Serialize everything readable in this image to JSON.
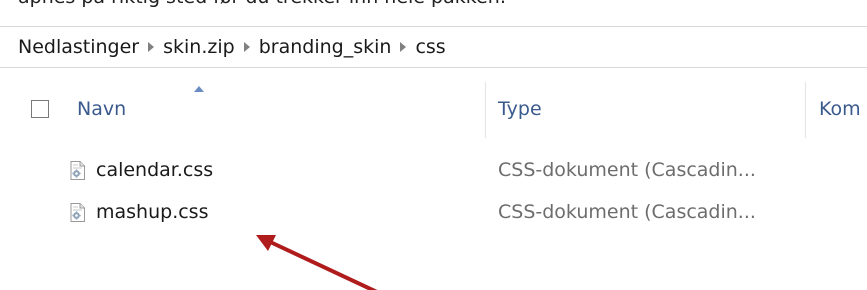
{
  "top_text": "åpnes på riktig sted før du trekker inn hele pakken:",
  "breadcrumb": {
    "items": [
      "Nedlastinger",
      "skin.zip",
      "branding_skin",
      "css"
    ]
  },
  "columns": {
    "name": "Navn",
    "type": "Type",
    "comment": "Kom"
  },
  "files": [
    {
      "name": "calendar.css",
      "type": "CSS-dokument (Cascadin..."
    },
    {
      "name": "mashup.css",
      "type": "CSS-dokument (Cascadin..."
    }
  ],
  "colors": {
    "header_text": "#3b5a8c",
    "annotation": "#b01c1c",
    "secondary_text": "#6d6d6d"
  },
  "icons": {
    "file": "css-file-icon",
    "separator": "chevron-right-icon",
    "sort": "sort-ascending-icon"
  }
}
